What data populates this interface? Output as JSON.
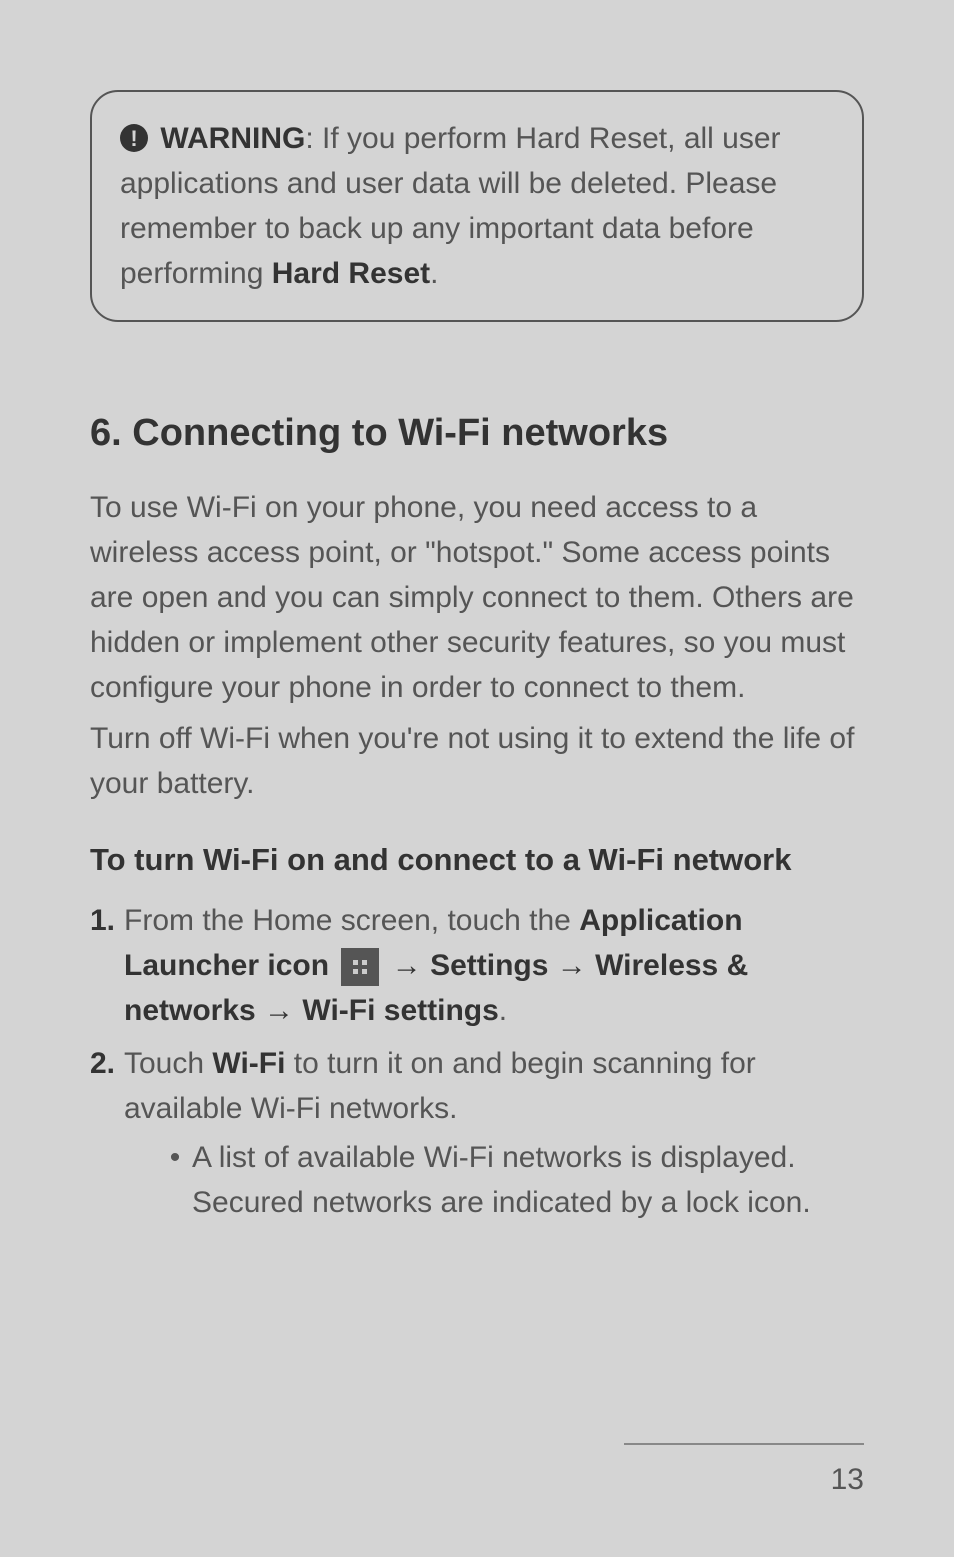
{
  "warning": {
    "label": "WARNING",
    "text_after_label": ": If you perform Hard Reset, all user applications and user data will be deleted. Please remember to back up any important data before performing ",
    "bold_tail": "Hard Reset",
    "period": "."
  },
  "section": {
    "heading": "6. Connecting to Wi-Fi networks",
    "para1": "To use Wi-Fi on your phone, you need access to a wireless access point, or \"hotspot.\" Some access points are open and you can simply connect to them. Others are hidden or implement other security features, so you must configure your phone in order to connect to them.",
    "para2": "Turn off Wi-Fi when you're not using it to extend the life of your battery."
  },
  "sub": {
    "heading": "To turn Wi-Fi on and connect to a Wi-Fi network"
  },
  "steps": {
    "s1_num": "1.",
    "s1_pre": "From the Home screen, touch the ",
    "s1_b1": "Application Launcher icon",
    "s1_arrow1": " → ",
    "s1_b2": "Settings",
    "s1_arrow2": " → ",
    "s1_b3": "Wireless & networks",
    "s1_arrow3": " → ",
    "s1_b4": "Wi-Fi settings",
    "s1_period": ".",
    "s2_num": "2.",
    "s2_pre": "Touch ",
    "s2_b1": "Wi-Fi",
    "s2_post": " to turn it on and begin scanning for available Wi-Fi networks.",
    "bullet1": "A list of available Wi-Fi networks is displayed. Secured networks are indicated by a lock icon."
  },
  "page_number": "13"
}
